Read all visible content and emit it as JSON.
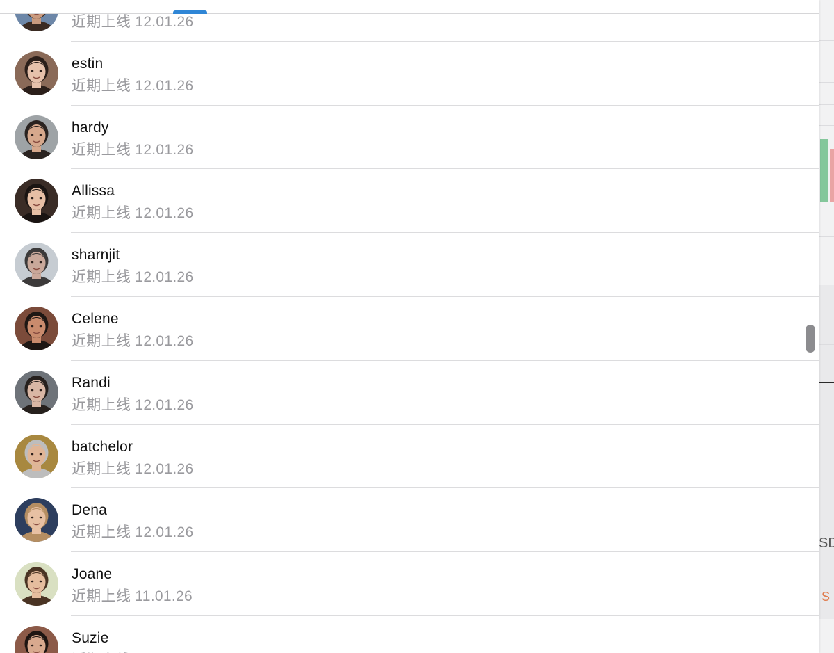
{
  "contacts": [
    {
      "name": "",
      "status": "近期上线 12.01.26",
      "skin": "#c99a7e",
      "hair": "#3a2a22",
      "bg": "#6d87a8"
    },
    {
      "name": "estin",
      "status": "近期上线 12.01.26",
      "skin": "#e6c1ab",
      "hair": "#2b1f1a",
      "bg": "#8a6a58"
    },
    {
      "name": "hardy",
      "status": "近期上线 12.01.26",
      "skin": "#d6a88c",
      "hair": "#2a2320",
      "bg": "#9ea3a6"
    },
    {
      "name": "Allissa",
      "status": "近期上线 12.01.26",
      "skin": "#e7bfa5",
      "hair": "#1a1412",
      "bg": "#3a2c26"
    },
    {
      "name": "sharnjit",
      "status": "近期上线 12.01.26",
      "skin": "#c9a89a",
      "hair": "#3c3a3a",
      "bg": "#c6ccd2"
    },
    {
      "name": "Celene",
      "status": "近期上线 12.01.26",
      "skin": "#c98b6d",
      "hair": "#1e1714",
      "bg": "#7b4b3a"
    },
    {
      "name": "Randi",
      "status": "近期上线 12.01.26",
      "skin": "#d9b7a5",
      "hair": "#26201d",
      "bg": "#6e7379"
    },
    {
      "name": "batchelor",
      "status": "近期上线 12.01.26",
      "skin": "#e0b596",
      "hair": "#bdbdbd",
      "bg": "#a8883f"
    },
    {
      "name": "Dena",
      "status": "近期上线 12.01.26",
      "skin": "#e7c0a3",
      "hair": "#b58e62",
      "bg": "#2d3e5e"
    },
    {
      "name": "Joane",
      "status": "近期上线 11.01.26",
      "skin": "#e5bd9e",
      "hair": "#4a3424",
      "bg": "#d9e0c2"
    },
    {
      "name": "Suzie",
      "status": "近期上线",
      "skin": "#d8a98e",
      "hair": "#1e1512",
      "bg": "#8c5a48"
    }
  ],
  "colors": {
    "accent": "#2f86d6",
    "status_text": "#9a9a9e",
    "name_text": "#111111",
    "divider": "#dcdcde"
  },
  "background_app": {
    "partial_label": "SD",
    "partial_accent": "S"
  }
}
